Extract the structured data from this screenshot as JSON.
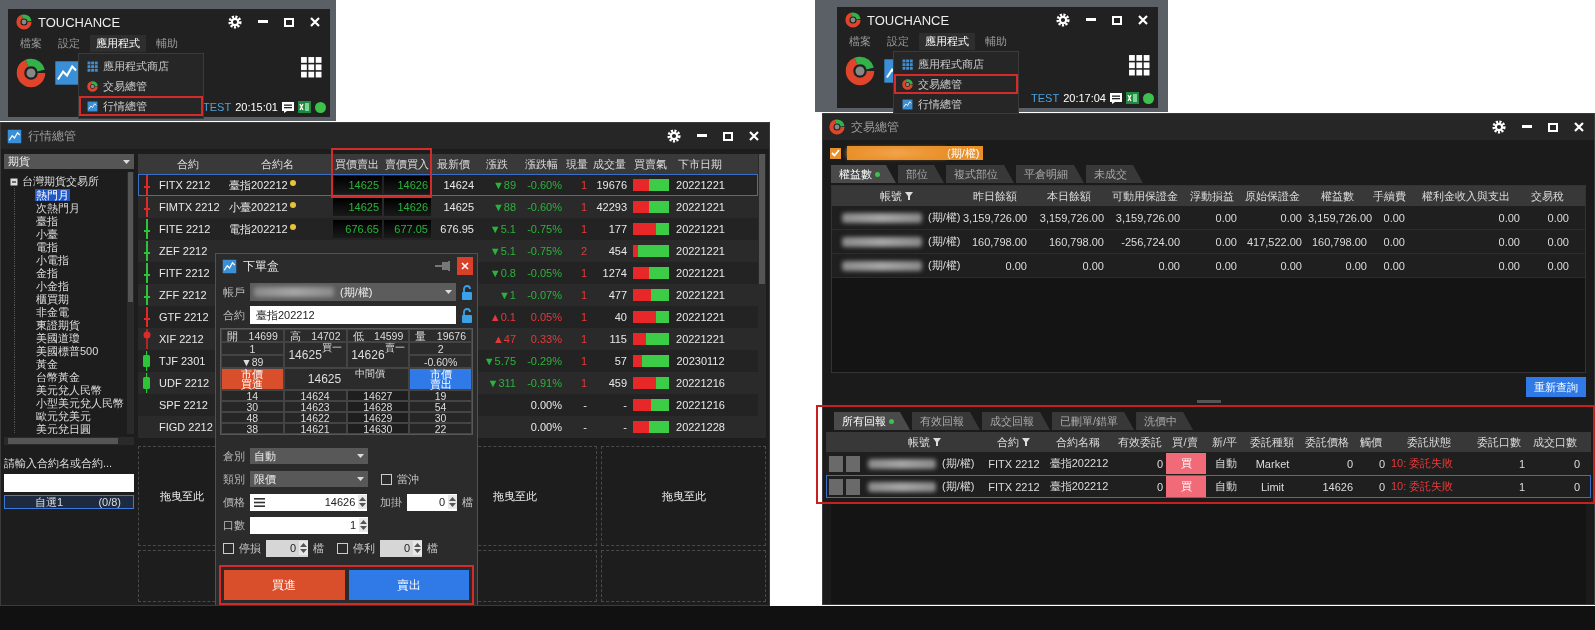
{
  "launchers": [
    {
      "title": "TOUCHANCE",
      "menus": [
        {
          "label": "檔案",
          "selected": false
        },
        {
          "label": "設定",
          "selected": false
        },
        {
          "label": "應用程式",
          "selected": true
        },
        {
          "label": "輔助",
          "selected": false
        }
      ],
      "dropdown": [
        {
          "kind": "store",
          "label": "應用程式商店",
          "highlighted": false
        },
        {
          "kind": "trade",
          "label": "交易總管",
          "highlighted": false
        },
        {
          "kind": "quote",
          "label": "行情總管",
          "highlighted": true
        }
      ],
      "status": {
        "mode": "TEST",
        "time": "20:15:01"
      }
    },
    {
      "title": "TOUCHANCE",
      "menus": [
        {
          "label": "檔案",
          "selected": false
        },
        {
          "label": "設定",
          "selected": false
        },
        {
          "label": "應用程式",
          "selected": true
        },
        {
          "label": "輔助",
          "selected": false
        }
      ],
      "dropdown": [
        {
          "kind": "store",
          "label": "應用程式商店",
          "highlighted": false
        },
        {
          "kind": "trade",
          "label": "交易總管",
          "highlighted": true
        },
        {
          "kind": "quote",
          "label": "行情總管",
          "highlighted": false
        }
      ],
      "status": {
        "mode": "TEST",
        "time": "20:17:04"
      }
    }
  ],
  "quote_window": {
    "title": "行情總管",
    "category": "期貨",
    "tree": {
      "label": "台灣期貨交易所",
      "expanded": true,
      "children": [
        {
          "label": "熱門月",
          "selected": true
        },
        {
          "label": "次熱門月",
          "selected": false
        },
        {
          "label": "臺指",
          "selected": false
        },
        {
          "label": "小臺",
          "selected": false
        },
        {
          "label": "電指",
          "selected": false
        },
        {
          "label": "小電指",
          "selected": false
        },
        {
          "label": "金指",
          "selected": false
        },
        {
          "label": "小金指",
          "selected": false
        },
        {
          "label": "櫃買期",
          "selected": false
        },
        {
          "label": "非金電",
          "selected": false
        },
        {
          "label": "東證期貨",
          "selected": false
        },
        {
          "label": "美國道瓊",
          "selected": false
        },
        {
          "label": "美國標普500",
          "selected": false
        },
        {
          "label": "黃金",
          "selected": false
        },
        {
          "label": "台幣黃金",
          "selected": false
        },
        {
          "label": "美元兌人民幣",
          "selected": false
        },
        {
          "label": "小型美元兌人民幣",
          "selected": false
        },
        {
          "label": "歐元兌美元",
          "selected": false
        },
        {
          "label": "美元兌日圓",
          "selected": false
        }
      ]
    },
    "search_label": "請輸入合約名或合約...",
    "watchlists": [
      {
        "name": "自選1",
        "count": "(0/8)",
        "selected": true
      }
    ],
    "columns": [
      "合約",
      "合約名",
      "買價賣出",
      "賣價買入",
      "最新價",
      "漲跌",
      "漲跌幅",
      "現量",
      "成交量",
      "買賣氣",
      "下市日期"
    ],
    "bid_ask_highlighted": true,
    "rows": [
      {
        "marker": {
          "kind": "line",
          "color": "#e02a2a"
        },
        "contract": "FITX 2212",
        "name": "臺指202212",
        "flagged": true,
        "bid": "14625",
        "ask": "14626",
        "last": "14624",
        "change": {
          "text": "▼89",
          "color": "#2cb23c"
        },
        "pct": "-0.60%",
        "qty": "1",
        "volume": "19676",
        "buy_sell": {
          "level": 0.45
        },
        "expiry": "20221221",
        "selected": true
      },
      {
        "marker": {
          "kind": "line",
          "color": "#e02a2a"
        },
        "contract": "FIMTX 2212",
        "name": "小臺202212",
        "flagged": true,
        "bid": "14625",
        "ask": "14626",
        "last": "14625",
        "change": {
          "text": "▼88",
          "color": "#2cb23c"
        },
        "pct": "-0.60%",
        "qty": "1",
        "volume": "42293",
        "buy_sell": {
          "level": 0.45
        },
        "expiry": "20221221",
        "selected": false
      },
      {
        "marker": {
          "kind": "line",
          "color": "#2ec43a"
        },
        "contract": "FITE 2212",
        "name": "電指202212",
        "flagged": true,
        "bid": "676.65",
        "ask": "677.05",
        "last": "676.95",
        "change": {
          "text": "▼5.1",
          "color": "#2cb23c"
        },
        "pct": "-0.75%",
        "qty": "1",
        "volume": "177",
        "buy_sell": {
          "level": 0.65
        },
        "expiry": "20221221",
        "selected": false
      },
      {
        "marker": {
          "kind": "line",
          "color": "#2ec43a"
        },
        "contract": "ZEF 2212",
        "change": {
          "text": "▼5.1",
          "color": "#2cb23c"
        },
        "pct": "-0.75%",
        "qty": "2",
        "volume": "454",
        "buy_sell": {
          "level": 0.15
        },
        "expiry": "20221221",
        "selected": false
      },
      {
        "marker": {
          "kind": "line",
          "color": "#2ec43a"
        },
        "contract": "FITF 2212",
        "change": {
          "text": "▼0.8",
          "color": "#2cb23c"
        },
        "pct": "-0.05%",
        "qty": "1",
        "volume": "1274",
        "buy_sell": {
          "level": 0.45
        },
        "expiry": "20221221",
        "selected": false
      },
      {
        "marker": {
          "kind": "line",
          "color": "#2ec43a"
        },
        "contract": "ZFF 2212",
        "change": {
          "text": "▼1",
          "color": "#2cb23c"
        },
        "pct": "-0.07%",
        "qty": "1",
        "volume": "477",
        "buy_sell": {
          "level": 0.5
        },
        "expiry": "20221221",
        "selected": false
      },
      {
        "marker": {
          "kind": "line",
          "color": "#e02a2a"
        },
        "contract": "GTF 2212",
        "change": {
          "text": "▲0.1",
          "color": "#e23a3a"
        },
        "pct": "0.05%",
        "qty": "1",
        "volume": "40",
        "buy_sell": {
          "level": 0.65
        },
        "expiry": "20221221",
        "selected": false
      },
      {
        "marker": {
          "kind": "dot",
          "color": "#e02a2a"
        },
        "contract": "XIF 2212",
        "change": {
          "text": "▲47",
          "color": "#e23a3a"
        },
        "pct": "0.33%",
        "qty": "1",
        "volume": "115",
        "buy_sell": {
          "level": 0.35
        },
        "expiry": "20221221",
        "selected": false
      },
      {
        "marker": {
          "kind": "bar",
          "color": "#2ec43a"
        },
        "contract": "TJF 2301",
        "change": {
          "text": "▼5.75",
          "color": "#2cb23c"
        },
        "pct": "-0.29%",
        "qty": "1",
        "volume": "57",
        "buy_sell": {
          "level": 0.25
        },
        "expiry": "20230112",
        "selected": false
      },
      {
        "marker": {
          "kind": "bar",
          "color": "#2ec43a"
        },
        "contract": "UDF 2212",
        "change": {
          "text": "▼311",
          "color": "#2cb23c"
        },
        "pct": "-0.91%",
        "qty": "1",
        "volume": "459",
        "buy_sell": {
          "level": 0.65
        },
        "expiry": "20221216",
        "selected": false
      },
      {
        "contract": "SPF 2212",
        "pct": "0.00%",
        "qty": "-",
        "volume": "-",
        "buy_sell": {
          "level": 0.5
        },
        "expiry": "20221216",
        "selected": false
      },
      {
        "contract": "FIGD 2212",
        "pct": "0.00%",
        "qty": "-",
        "volume": "-",
        "buy_sell": {
          "level": 0.45
        },
        "expiry": "20221228",
        "selected": false
      }
    ],
    "drop_panels": [
      {
        "label": "拖曳至此"
      },
      {
        "label": "拖曳至此"
      },
      {
        "label": "拖曳至此"
      }
    ],
    "order_dialog": {
      "title": "下單盒",
      "account_label": "帳戶",
      "account_suffix": "(期/權)",
      "contract_label": "合約",
      "contract_value": "臺指202212",
      "stats": [
        {
          "label": "開",
          "value": "14699"
        },
        {
          "label": "高",
          "value": "14702"
        },
        {
          "label": "低",
          "value": "14599"
        },
        {
          "label": "量",
          "value": "19676"
        }
      ],
      "best": {
        "bid_qty": "1",
        "change": "▼89",
        "bid": "14625",
        "bid_tag": "買一",
        "ask": "14626",
        "ask_tag": "賣一",
        "ask_qty": "2",
        "pct": "-0.60%"
      },
      "market_buy": "市價買進",
      "mid": "14625",
      "mid_tag": "中間價",
      "market_sell": "市價賣出",
      "depth": [
        [
          "14",
          "14624",
          "14627",
          "19"
        ],
        [
          "30",
          "14623",
          "14628",
          "54"
        ],
        [
          "48",
          "14622",
          "14629",
          "30"
        ],
        [
          "38",
          "14621",
          "14630",
          "22"
        ]
      ],
      "position": {
        "label": "倉別",
        "value": "自動"
      },
      "order_type": {
        "label": "類別",
        "value": "限價"
      },
      "day_trade": {
        "label": "當沖",
        "checked": false
      },
      "price": {
        "label": "價格",
        "value": "14626"
      },
      "tick_add": {
        "label": "加掛",
        "value": "0",
        "unit": "檔"
      },
      "quantity": {
        "label": "口數",
        "value": "1"
      },
      "stop_loss": {
        "label": "停損",
        "checked": false,
        "value": "0",
        "unit": "檔"
      },
      "take_profit": {
        "label": "停利",
        "checked": false,
        "value": "0",
        "unit": "檔"
      },
      "buy_button": "買進",
      "sell_button": "賣出",
      "buttons_highlighted": true
    }
  },
  "trade_window": {
    "title": "交易總管",
    "account": {
      "checked": true,
      "suffix": "(期/權)"
    },
    "tabs": [
      {
        "label": "權益數",
        "live": true,
        "selected": true
      },
      {
        "label": "部位",
        "live": false,
        "selected": false
      },
      {
        "label": "複式部位",
        "live": false,
        "selected": false
      },
      {
        "label": "平倉明細",
        "live": false,
        "selected": false
      },
      {
        "label": "未成交",
        "live": false,
        "selected": false
      }
    ],
    "columns": [
      {
        "label": "帳號",
        "filter": true
      },
      {
        "label": "昨日餘額",
        "filter": false
      },
      {
        "label": "本日餘額",
        "filter": false
      },
      {
        "label": "可動用保證金",
        "filter": false
      },
      {
        "label": "浮動損益",
        "filter": false
      },
      {
        "label": "原始保證金",
        "filter": false
      },
      {
        "label": "權益數",
        "filter": false
      },
      {
        "label": "手續費",
        "filter": false
      },
      {
        "label": "權利金收入與支出",
        "filter": false
      },
      {
        "label": "交易稅",
        "filter": false
      }
    ],
    "rows": [
      {
        "suffix": "(期/權)",
        "values": [
          "3,159,726.00",
          "3,159,726.00",
          "3,159,726.00",
          "0.00",
          "0.00",
          "3,159,726.00",
          "0.00",
          "0.00",
          "0.00"
        ]
      },
      {
        "suffix": "(期/權)",
        "values": [
          "160,798.00",
          "160,798.00",
          "-256,724.00",
          "0.00",
          "417,522.00",
          "160,798.00",
          "0.00",
          "0.00",
          "0.00"
        ]
      },
      {
        "suffix": "(期/權)",
        "values": [
          "0.00",
          "0.00",
          "0.00",
          "0.00",
          "0.00",
          "0.00",
          "0.00",
          "0.00",
          "0.00"
        ]
      }
    ],
    "refresh_button": "重新查詢",
    "reports_highlighted": true,
    "report_tabs": [
      {
        "label": "所有回報",
        "live": true,
        "selected": true
      },
      {
        "label": "有效回報",
        "live": false,
        "selected": false
      },
      {
        "label": "成交回報",
        "live": false,
        "selected": false
      },
      {
        "label": "已刪單/錯單",
        "live": false,
        "selected": false
      },
      {
        "label": "洗價中",
        "live": false,
        "selected": false
      }
    ],
    "report_columns": [
      {
        "label": "帳號",
        "filter": true
      },
      {
        "label": "合約",
        "filter": true
      },
      {
        "label": "合約名稱",
        "filter": false
      },
      {
        "label": "有效委託",
        "filter": false
      },
      {
        "label": "買/賣",
        "filter": false
      },
      {
        "label": "新/平",
        "filter": false
      },
      {
        "label": "委託種類",
        "filter": false
      },
      {
        "label": "委託價格",
        "filter": false
      },
      {
        "label": "觸價",
        "filter": false
      },
      {
        "label": "委託狀態",
        "filter": false
      },
      {
        "label": "委託口數",
        "filter": false
      },
      {
        "label": "成交口數",
        "filter": false
      }
    ],
    "reports": [
      {
        "suffix": "(期/權)",
        "contract": "FITX 2212",
        "name": "臺指202212",
        "active": "0",
        "side": "買",
        "open_close": "自動",
        "order_type": "Market",
        "price": "0",
        "trigger": "0",
        "status": "10: 委託失敗",
        "qty": "1",
        "filled": "0",
        "selected": false
      },
      {
        "suffix": "(期/權)",
        "contract": "FITX 2212",
        "name": "臺指202212",
        "active": "0",
        "side": "買",
        "open_close": "自動",
        "order_type": "Limit",
        "price": "14626",
        "trigger": "0",
        "status": "10: 委託失敗",
        "qty": "1",
        "filled": "0",
        "selected": true
      }
    ]
  }
}
